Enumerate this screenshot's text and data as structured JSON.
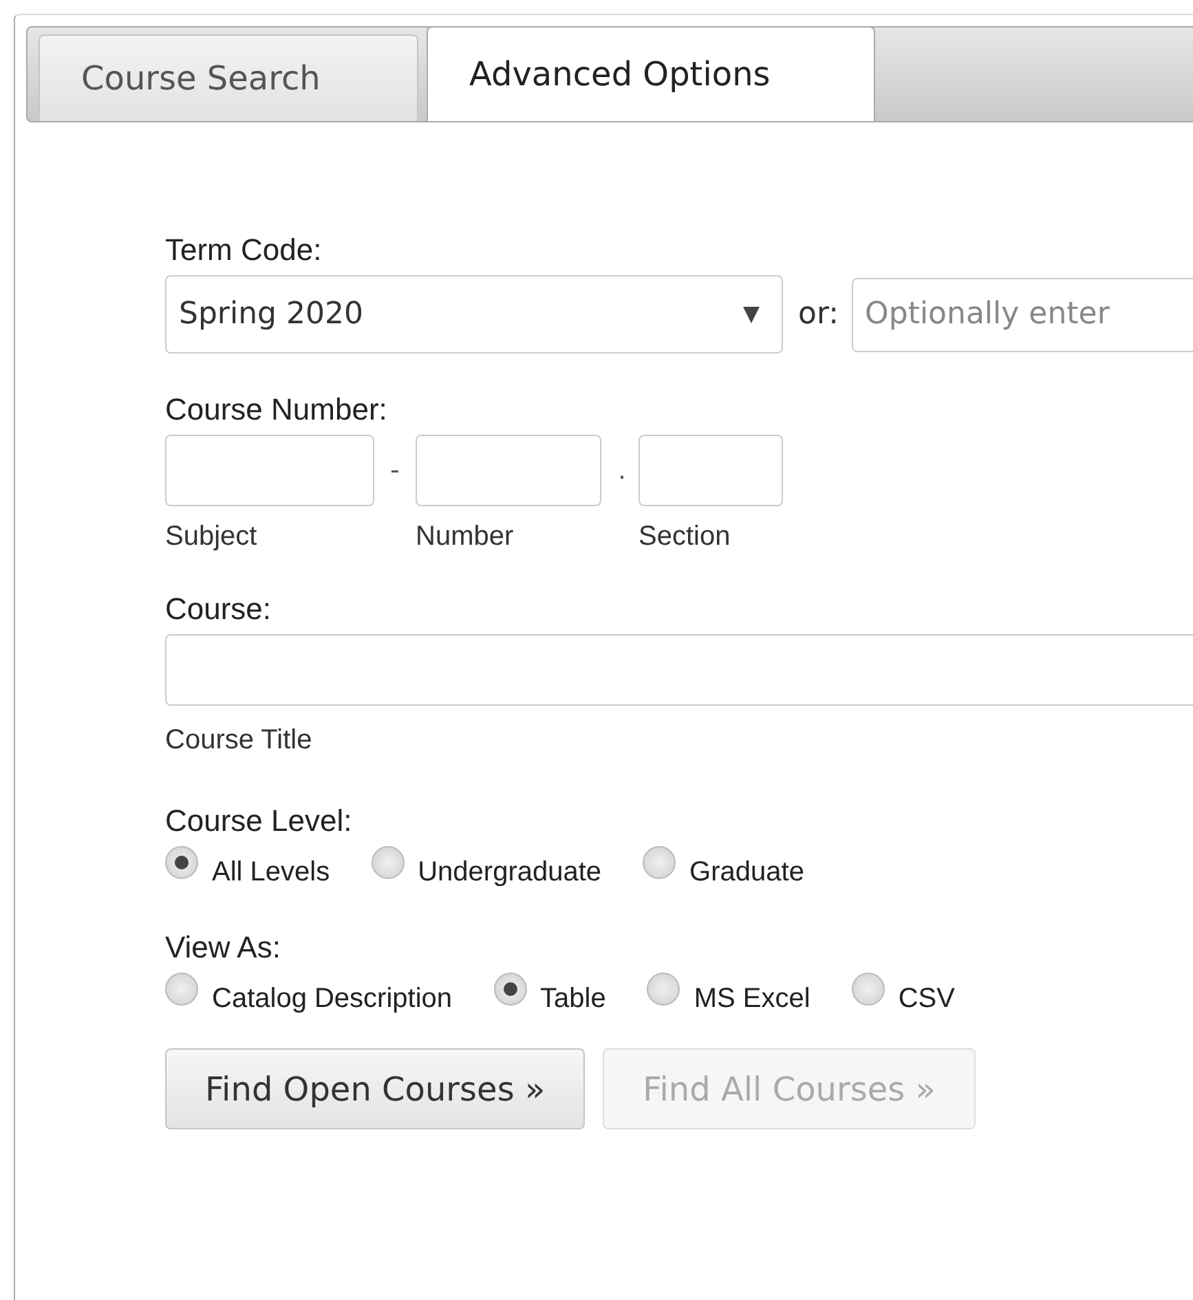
{
  "tabs": [
    {
      "label": "Course Search",
      "selected": false
    },
    {
      "label": "Advanced Options",
      "selected": true
    }
  ],
  "term_code": {
    "label": "Term Code:",
    "value": "Spring 2020",
    "separator": "or:"
  },
  "term_entry": {
    "placeholder": "Optionally enter"
  },
  "course_number": {
    "label": "Course Number:",
    "fields": [
      {
        "caption": "Subject",
        "separator": "-"
      },
      {
        "caption": "Number",
        "separator": "."
      },
      {
        "caption": "Section"
      }
    ]
  },
  "course": {
    "label": "Course:",
    "caption": "Course Title"
  },
  "course_level": {
    "label": "Course Level:",
    "options": [
      {
        "label": "All Levels",
        "selected": true
      },
      {
        "label": "Undergraduate",
        "selected": false
      },
      {
        "label": "Graduate",
        "selected": false
      }
    ]
  },
  "view_as": {
    "label": "View As:",
    "options": [
      {
        "label": "Catalog Description",
        "selected": false
      },
      {
        "label": "Table",
        "selected": true
      },
      {
        "label": "MS Excel",
        "selected": false
      },
      {
        "label": "CSV",
        "selected": false
      }
    ]
  },
  "buttons": [
    {
      "label": "Find Open Courses »",
      "disabled": false
    },
    {
      "label": "Find All Courses »",
      "disabled": true
    }
  ]
}
